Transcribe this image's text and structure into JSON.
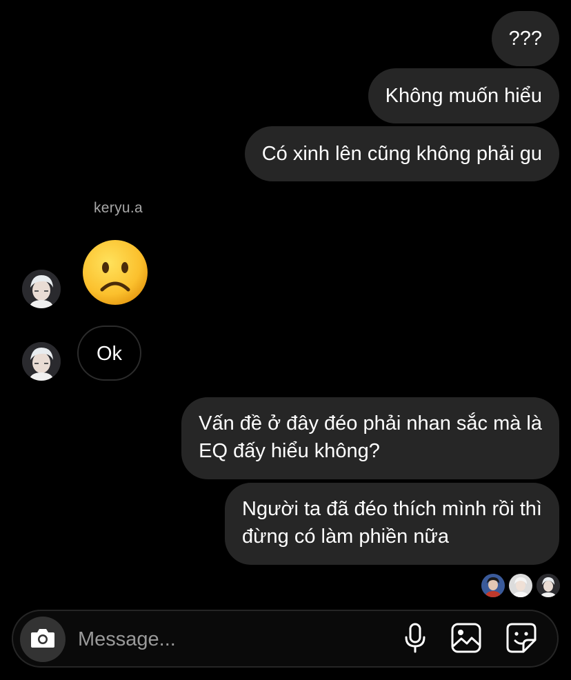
{
  "messages": {
    "sent_1": "???",
    "sent_2": "Không muốn hiểu",
    "sent_3": "Có xinh lên cũng không phải gu",
    "sender_name": "keryu.a",
    "received_emoji": "frowning-face",
    "received_text": "Ok",
    "sent_4": [
      "Vấn đề ở đây đéo phải nhan sắc mà là",
      "EQ đấy hiểu không?"
    ],
    "sent_5": [
      "Người ta đã đéo thích mình rồi thì",
      "đừng có làm phiền nữa"
    ]
  },
  "composer": {
    "placeholder": "Message...",
    "icons": [
      "camera-icon",
      "microphone-icon",
      "gallery-icon",
      "sticker-icon"
    ]
  },
  "seen_by": [
    "seen-avatar-1",
    "seen-avatar-2",
    "seen-avatar-3"
  ],
  "colors": {
    "background": "#000000",
    "sent_bubble": "#262626",
    "secondary_text": "#a8a8a8"
  }
}
